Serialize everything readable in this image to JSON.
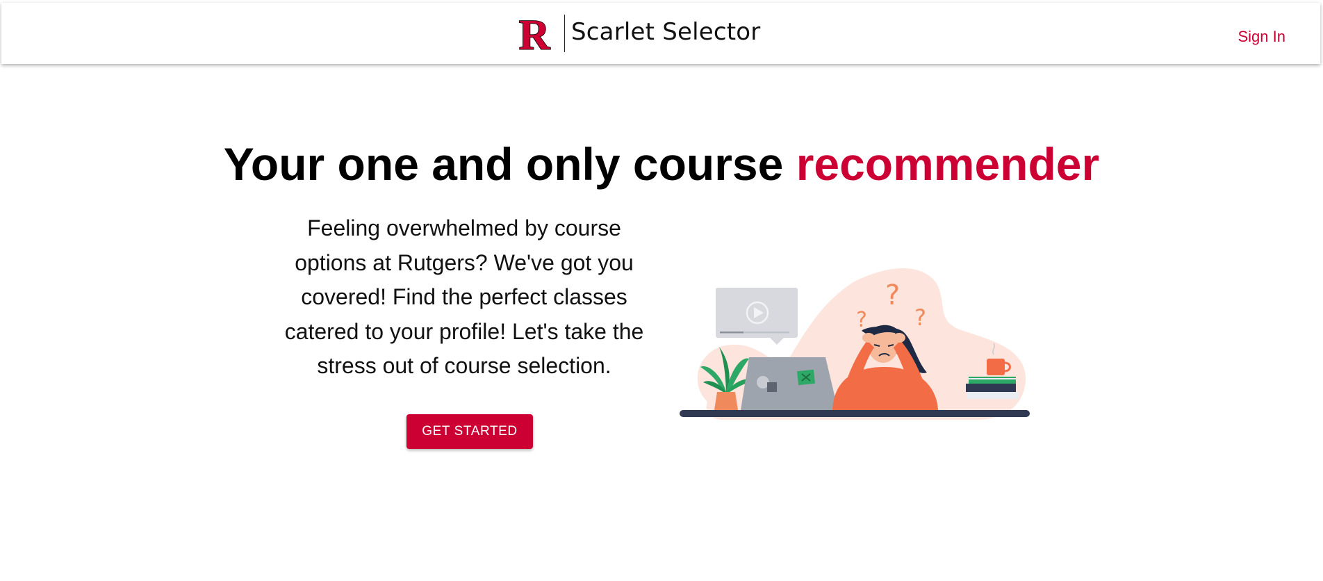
{
  "header": {
    "logo_letter": "R",
    "brand_name": "Scarlet Selector",
    "sign_in_label": "Sign In"
  },
  "hero": {
    "title_main": "Your one and only course ",
    "title_accent": "recommender",
    "description": "Feeling overwhelmed by course options at Rutgers? We've got you covered! Find the perfect classes catered to your profile! Let's take the stress out of course selection.",
    "cta_label": "GET STARTED"
  },
  "colors": {
    "brand_red": "#cc0033",
    "illustration_blob": "#fde4dc",
    "shirt_orange": "#f26d45",
    "desk_navy": "#2f3a52"
  },
  "icons": {
    "logo": "rutgers-r-logo",
    "video": "play-icon",
    "question_marks": "question-mark-icon"
  }
}
